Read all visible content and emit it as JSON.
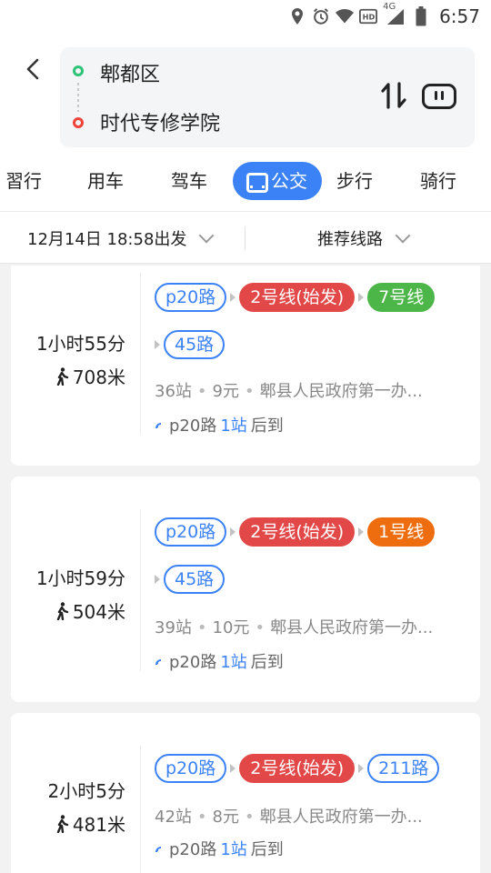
{
  "status": {
    "network": "4G",
    "time": "6:57"
  },
  "route": {
    "start": "郫都区",
    "end": "时代专修学院"
  },
  "tabs": [
    {
      "label": "智行",
      "visible_text": "習行"
    },
    {
      "label": "用车"
    },
    {
      "label": "驾车"
    },
    {
      "label": "公交",
      "active": true
    },
    {
      "label": "步行"
    },
    {
      "label": "骑行"
    }
  ],
  "filters": {
    "departure": "12月14日 18:58出发",
    "sort": "推荐线路"
  },
  "colors": {
    "accent": "#3b82f6",
    "line_red": "#e24848",
    "line_green": "#4cb748",
    "line_orange": "#ee6d0e"
  },
  "results": [
    {
      "duration": "1小时55分",
      "walk": "708米",
      "lines": [
        "p20路",
        "2号线(始发)",
        "7号线",
        "45路"
      ],
      "stops": "36站",
      "fare": "9元",
      "via": "郫县人民政府第一办...",
      "arrive_prefix": "p20路",
      "arrive_count": "1站",
      "arrive_suffix": "后到"
    },
    {
      "duration": "1小时59分",
      "walk": "504米",
      "lines": [
        "p20路",
        "2号线(始发)",
        "1号线",
        "45路"
      ],
      "stops": "39站",
      "fare": "10元",
      "via": "郫县人民政府第一办...",
      "arrive_prefix": "p20路",
      "arrive_count": "1站",
      "arrive_suffix": "后到"
    },
    {
      "duration": "2小时5分",
      "walk": "481米",
      "lines": [
        "p20路",
        "2号线(始发)",
        "211路"
      ],
      "stops": "42站",
      "fare": "8元",
      "via": "郫县人民政府第一办...",
      "arrive_prefix": "p20路",
      "arrive_count": "1站",
      "arrive_suffix": "后到"
    }
  ]
}
